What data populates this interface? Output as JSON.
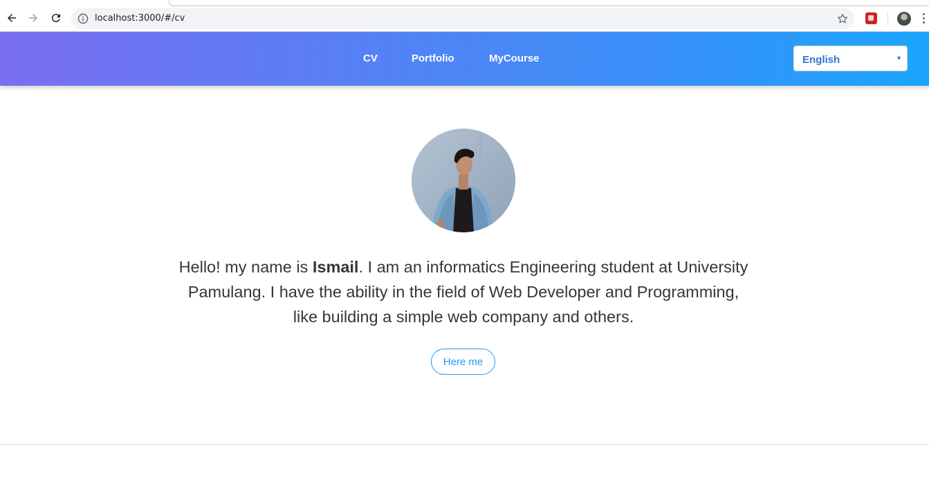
{
  "browser": {
    "url": "localhost:3000/#/cv"
  },
  "nav": {
    "items": [
      {
        "label": "CV"
      },
      {
        "label": "Portfolio"
      },
      {
        "label": "MyCourse"
      }
    ],
    "language": {
      "selected": "English"
    }
  },
  "profile": {
    "intro_before": "Hello! my name is ",
    "name": "Ismail",
    "intro_after": ". I am an informatics Engineering student at University Pamulang. I have the ability in the field of Web Developer and Programming, like building a simple web company and others.",
    "cta_label": "Here me"
  },
  "colors": {
    "header_gradient_start": "#7a6ef0",
    "header_gradient_end": "#1aa5fc",
    "accent": "#209cee",
    "select_text": "#3273dc"
  }
}
